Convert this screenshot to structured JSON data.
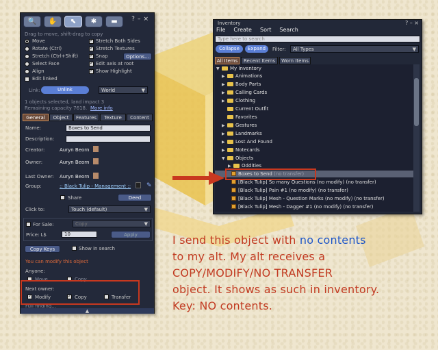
{
  "build": {
    "toolbar_hint": "Drag to move, shift-drag to copy",
    "help": "?",
    "minimize": "–",
    "close": "×",
    "edit_modes": [
      {
        "label": "Move",
        "selected": true
      },
      {
        "label": "Rotate (Ctrl)",
        "selected": false
      },
      {
        "label": "Stretch (Ctrl+Shift)",
        "selected": false
      },
      {
        "label": "Select Face",
        "selected": false
      },
      {
        "label": "Align",
        "selected": false
      }
    ],
    "edit_linked": "Edit linked",
    "options_right": [
      {
        "label": "Stretch Both Sides",
        "checked": true
      },
      {
        "label": "Stretch Textures",
        "checked": true
      },
      {
        "label": "Snap",
        "checked": true
      },
      {
        "label": "Edit axis at root",
        "checked": true
      },
      {
        "label": "Show Highlight",
        "checked": true
      }
    ],
    "options_button": "Options...",
    "link_label": "Link:",
    "unlink_button": "Unlink",
    "world_select": "World",
    "selection_info": "1 objects selected, land impact 3",
    "remaining_capacity": "Remaining capacity 7618.",
    "more_info": "More info",
    "tabs": [
      "General",
      "Object",
      "Features",
      "Texture",
      "Content"
    ],
    "name_label": "Name:",
    "name_value": "Boxes to Send",
    "description_label": "Description:",
    "creator_label": "Creator:",
    "creator_value": "Auryn Beorn",
    "owner_label": "Owner:",
    "owner_value": "Auryn Beorn",
    "last_owner_label": "Last Owner:",
    "last_owner_value": "Auryn Beorn",
    "group_label": "Group:",
    "group_value": ":: Black Tulip - Management ::",
    "share_label": "Share",
    "deed_button": "Deed",
    "click_to_label": "Click to:",
    "click_to_value": "Touch (default)",
    "for_sale_label": "For Sale:",
    "sale_type": "Copy",
    "price_label": "Price: L$",
    "price_value": "10",
    "apply_button": "Apply",
    "copy_keys_button": "Copy Keys",
    "show_in_search": "Show in search",
    "modify_note": "You can modify this object",
    "anyone_label": "Anyone:",
    "anyone_move": "Move",
    "anyone_copy": "Copy",
    "next_owner_label": "Next owner:",
    "next_modify": "Modify",
    "next_copy": "Copy",
    "next_transfer": "Transfer",
    "cut_text": "Full finding..."
  },
  "inventory": {
    "title": "Inventory",
    "menu": [
      "File",
      "Create",
      "Sort",
      "Search"
    ],
    "search_placeholder": "Type here to search",
    "collapse_button": "Collapse",
    "expand_button": "Expand",
    "filter_label": "Filter:",
    "filter_value": "All Types",
    "tabs": [
      "All Items",
      "Recent Items",
      "Worn Items"
    ],
    "root": "My Inventory",
    "folders": [
      "Animations",
      "Body Parts",
      "Calling Cards",
      "Clothing",
      "Current Outfit",
      "Favorites",
      "Gestures",
      "Landmarks",
      "Lost And Found",
      "Notecards",
      "Objects"
    ],
    "subfolder": "Oddities",
    "selected_item": "Boxes to Send",
    "selected_item_perm": "(no transfer)",
    "items": [
      {
        "name": "[Black Tulip] So many Questions",
        "perm": "(no modify) (no transfer)"
      },
      {
        "name": "[Black Tulip] Pain #1",
        "perm": "(no modify) (no transfer)"
      },
      {
        "name": "[Black Tulip] Mesh - Question Marks",
        "perm": "(no modify) (no transfer)"
      },
      {
        "name": "[Black Tulip] Mesh - Dagger #1",
        "perm": "(no modify) (no transfer)"
      }
    ]
  },
  "note": {
    "line1_a": "I send this object with ",
    "line1_b": "no contents",
    "line2": "to my alt. My alt receives a",
    "line3": "COPY/MODIFY/NO TRANSFER",
    "line4": "object. It shows as such in inventory.",
    "line5": "Key: NO contents."
  },
  "colors": {
    "annotation_red": "#c23b22",
    "annotation_blue": "#1f57c7",
    "panel_bg": "#23293a",
    "highlight_box": "#c8381f"
  }
}
